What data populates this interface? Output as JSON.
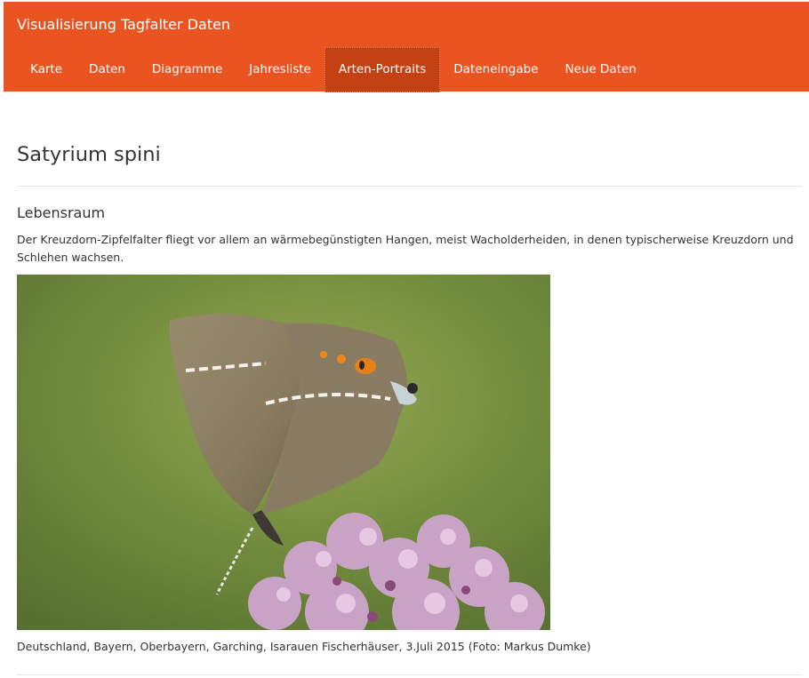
{
  "header": {
    "brand": "Visualisierung Tagfalter Daten",
    "accent_color": "#e95420",
    "active_color": "#c34113",
    "nav": [
      {
        "label": "Karte",
        "active": false
      },
      {
        "label": "Daten",
        "active": false
      },
      {
        "label": "Diagramme",
        "active": false
      },
      {
        "label": "Jahresliste",
        "active": false
      },
      {
        "label": "Arten-Portraits",
        "active": true
      },
      {
        "label": "Dateneingabe",
        "active": false
      },
      {
        "label": "Neue Daten",
        "active": false
      }
    ]
  },
  "main": {
    "title": "Satyrium spini",
    "section_title": "Lebensraum",
    "description": "Der Kreuzdorn-Zipfelfalter fliegt vor allem an wärmebegünstigten Hangen, meist Wacholderheiden, in denen typischerweise Kreuzdorn und Schlehen wachsen.",
    "photo_caption": "Deutschland, Bayern, Oberbayern, Garching, Isarauen Fischerhäuser, 3.Juli 2015 (Foto: Markus Dumke)"
  }
}
